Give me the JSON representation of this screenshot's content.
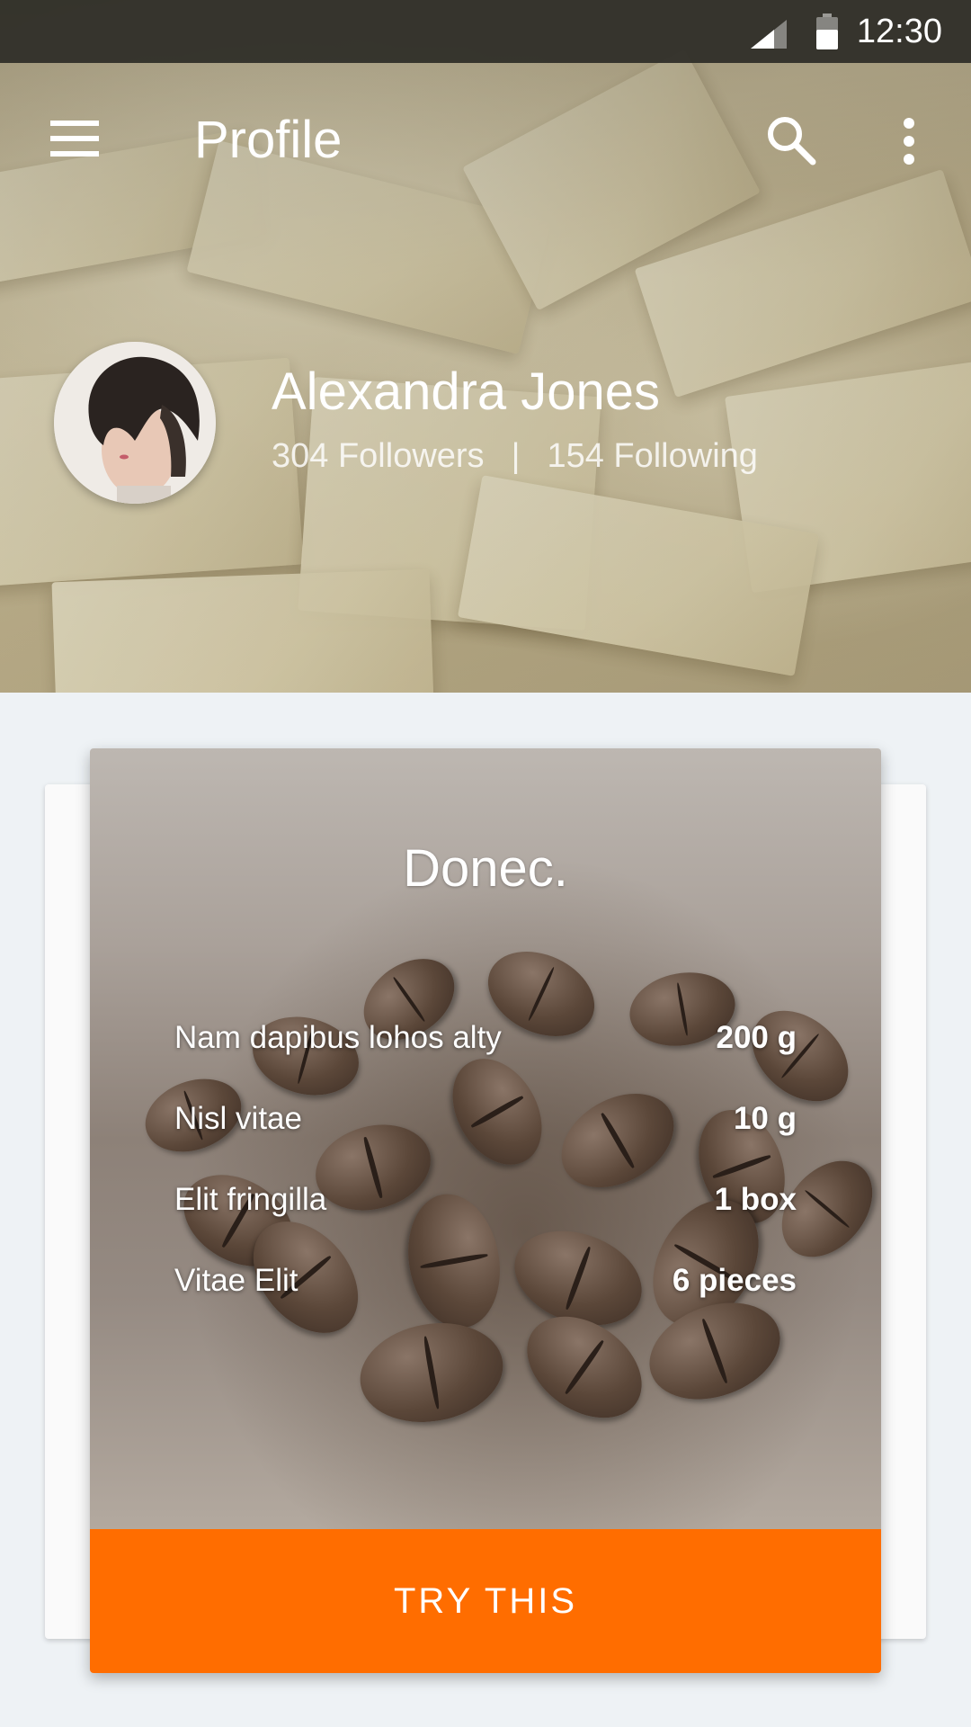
{
  "status_bar": {
    "time": "12:30",
    "icons": [
      "signal-icon",
      "battery-icon"
    ]
  },
  "toolbar": {
    "title": "Profile",
    "icons": [
      "menu-icon",
      "search-icon",
      "more-vert-icon"
    ]
  },
  "profile": {
    "name": "Alexandra Jones",
    "followers": "304 Followers",
    "separator": "|",
    "following": "154 Following"
  },
  "card": {
    "title": "Donec.",
    "ingredients": [
      {
        "name": "Nam dapibus lohos alty",
        "amount": "200 g"
      },
      {
        "name": "Nisl vitae",
        "amount": "10 g"
      },
      {
        "name": "Elit fringilla",
        "amount": "1 box"
      },
      {
        "name": "Vitae Elit",
        "amount": "6 pieces"
      }
    ],
    "button_label": "TRY THIS"
  },
  "colors": {
    "accent": "#ff6d00",
    "background": "#eef2f5",
    "status_bar": "#2d2b26"
  }
}
